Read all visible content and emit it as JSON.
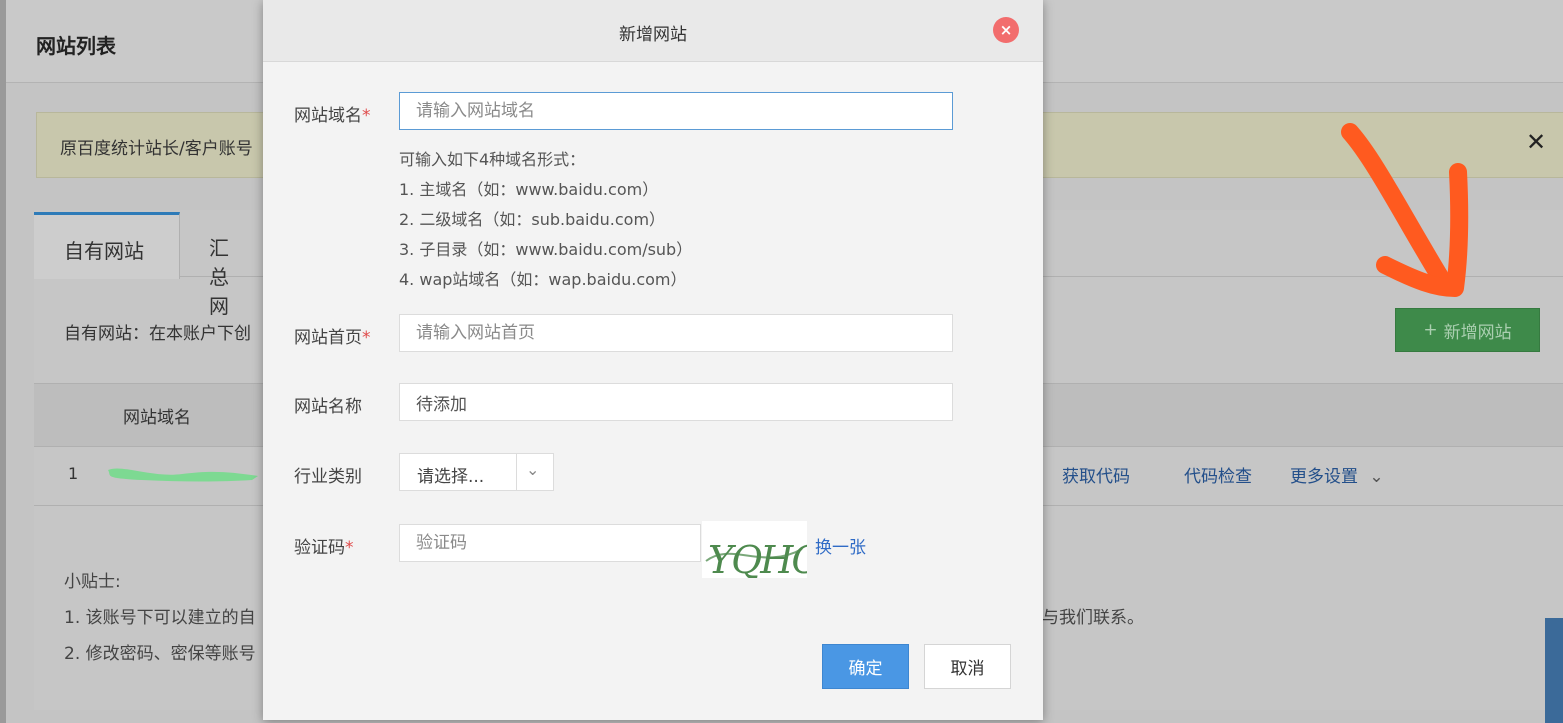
{
  "page": {
    "title": "网站列表",
    "notice_text": "原百度统计站长/客户账号",
    "notice_close": "✕",
    "tabs": [
      {
        "label": "自有网站"
      },
      {
        "label": "汇总网"
      }
    ],
    "own_site_desc": "自有网站：在本账户下创",
    "add_site_button": "新增网站",
    "table": {
      "header_domain": "网站域名",
      "rows": [
        {
          "index": "1"
        }
      ],
      "actions": [
        "获取代码",
        "代码检查",
        "更多设置"
      ]
    },
    "tips": {
      "title": "小贴士:",
      "line1": "1. 该账号下可以建立的自",
      "line1_end": "与我们联系。",
      "line2": "2. 修改密码、密保等账号"
    }
  },
  "modal": {
    "title": "新增网站",
    "close_icon": "×",
    "fields": {
      "domain": {
        "label": "网站域名",
        "required": "*",
        "placeholder": "请输入网站域名"
      },
      "domain_hint": {
        "intro": "可输入如下4种域名形式：",
        "items": [
          "1. 主域名（如：www.baidu.com）",
          "2. 二级域名（如：sub.baidu.com）",
          "3. 子目录（如：www.baidu.com/sub）",
          "4. wap站域名（如：wap.baidu.com）"
        ]
      },
      "homepage": {
        "label": "网站首页",
        "required": "*",
        "placeholder": "请输入网站首页"
      },
      "site_name": {
        "label": "网站名称",
        "value": "待添加"
      },
      "industry": {
        "label": "行业类别",
        "selected": "请选择..."
      },
      "captcha": {
        "label": "验证码",
        "required": "*",
        "placeholder": "验证码",
        "image_text": "YQHC",
        "refresh": "换一张"
      }
    },
    "buttons": {
      "ok": "确定",
      "cancel": "取消"
    }
  },
  "colors": {
    "primary_button": "#4a97e4",
    "add_button": "#3e8a4a",
    "link": "#2f6bc6",
    "required": "#e04b4b",
    "close_badge": "#f26d6d",
    "annotation_arrow": "#ff5a1f"
  }
}
